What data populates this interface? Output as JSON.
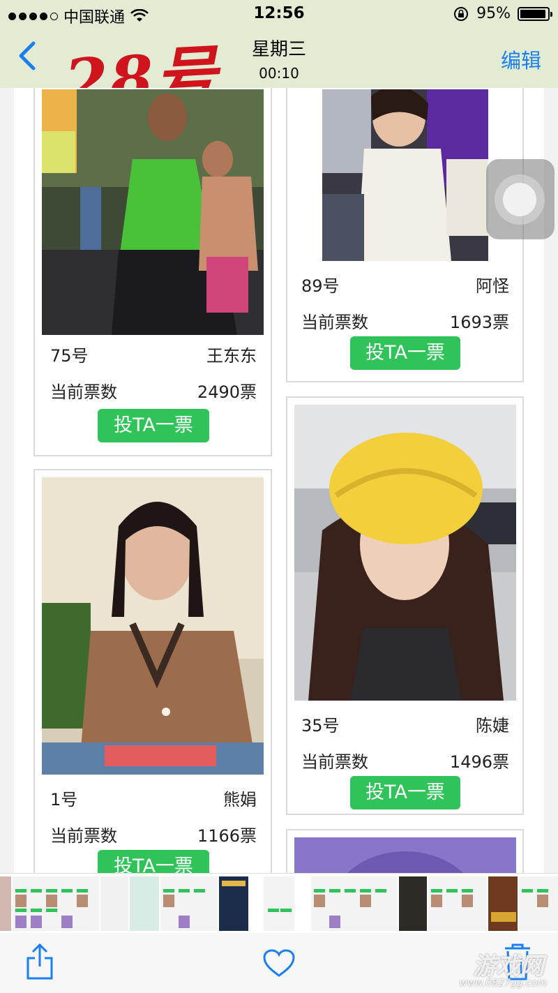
{
  "status_bar": {
    "carrier": "中国联通",
    "time": "12:56",
    "battery": "95%",
    "battery_level": 0.95
  },
  "nav": {
    "handwritten": "28号",
    "title": "星期三",
    "subtitle": "00:10",
    "edit": "编辑"
  },
  "cards": [
    {
      "number": "75号",
      "name": "王东东",
      "votes_label": "当前票数",
      "votes": "2490票",
      "button": "投TA一票"
    },
    {
      "number": "89号",
      "name": "阿怪",
      "votes_label": "当前票数",
      "votes": "1693票",
      "button": "投TA一票"
    },
    {
      "number": "1号",
      "name": "熊娟",
      "votes_label": "当前票数",
      "votes": "1166票",
      "button": "投TA一票"
    },
    {
      "number": "35号",
      "name": "陈婕",
      "votes_label": "当前票数",
      "votes": "1496票",
      "button": "投TA一票"
    }
  ],
  "toolbar": {
    "share": "share-icon",
    "favorite": "heart-icon",
    "delete": "trash-icon"
  },
  "watermark": {
    "text": "游戏网",
    "url": "www.0827gg.com"
  },
  "colors": {
    "nav_bg": "#e3ecd3",
    "accent": "#1a7ff0",
    "vote_button": "#2fc35a",
    "handwritten": "#d0141e"
  }
}
